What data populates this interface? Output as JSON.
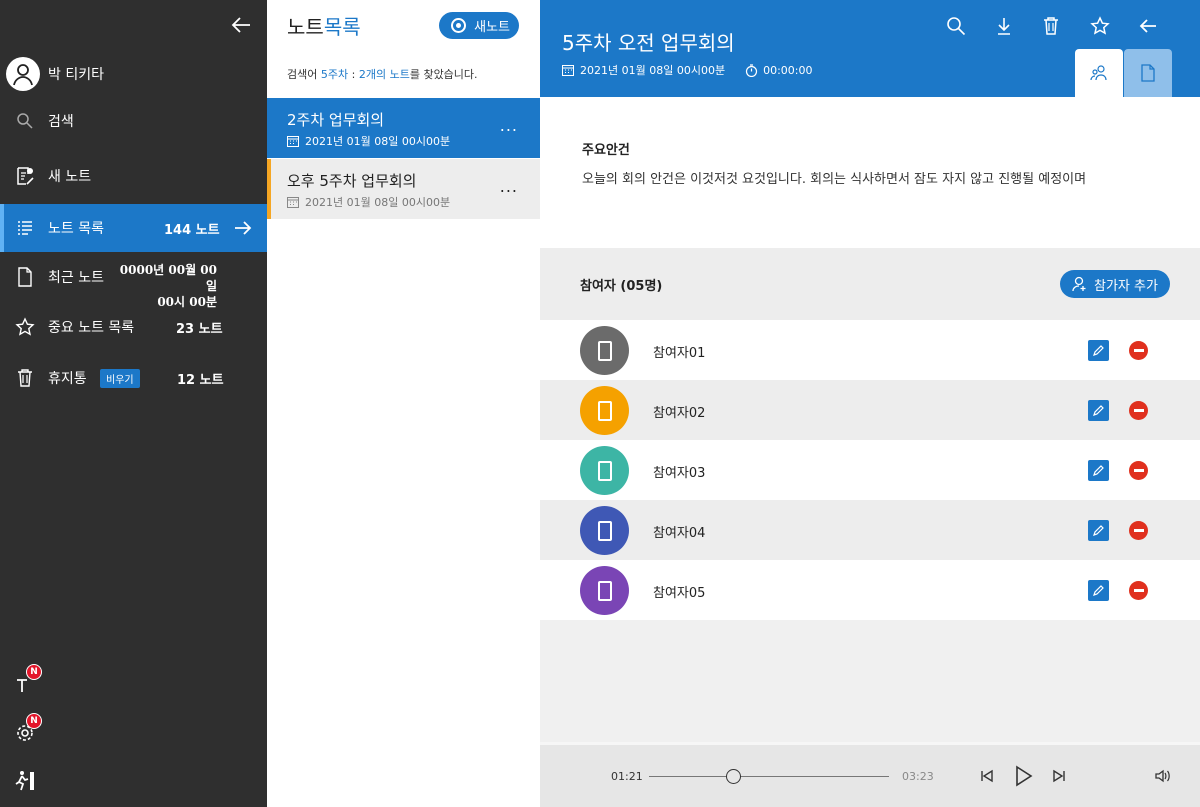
{
  "sidebar": {
    "user_name": "박 티키타",
    "items": [
      {
        "label": "검색"
      },
      {
        "label": "새 노트"
      },
      {
        "label": "노트 목록",
        "count": "144 노트"
      },
      {
        "label": "최근 노트",
        "date_line1": "0000년 00월 00일",
        "date_line2": "00시 00분"
      },
      {
        "label": "중요 노트 목록",
        "count": "23 노트"
      },
      {
        "label": "휴지통",
        "badge": "비우기",
        "count": "12 노트"
      }
    ],
    "bottom": {
      "badge_1": "N",
      "badge_2": "N"
    }
  },
  "notelist": {
    "title_part1": "노트",
    "title_part2": "목록",
    "new_button": "새노트",
    "search": {
      "prefix": "검색어",
      "keyword": "5주차",
      "colon": ":",
      "result": "2개의 노트",
      "suffix": "를 찾았습니다."
    },
    "notes": [
      {
        "title": "2주차 업무회의",
        "date": "2021년 01월 08일  00시00분",
        "more": "..."
      },
      {
        "title": "오후 5주차 업무회의",
        "date": "2021년 01월 08일  00시00분",
        "more": "..."
      }
    ]
  },
  "detail": {
    "title": "5주차 오전 업무회의",
    "date": "2021년 01월 08일  00시00분",
    "duration": "00:00:00",
    "agenda_title": "주요안건",
    "agenda_text": "오늘의 회의 안건은 이것저것 요것입니다. 회의는 식사하면서 잠도 자지 않고 진행될 예정이며",
    "participants_title": "참여자 (05명)",
    "add_participant": "참가자 추가",
    "participants": [
      {
        "name": "참여자01",
        "color": "#6b6b6b"
      },
      {
        "name": "참여자02",
        "color": "#f5a100"
      },
      {
        "name": "참여자03",
        "color": "#3db5a5"
      },
      {
        "name": "참여자04",
        "color": "#3f58b5"
      },
      {
        "name": "참여자05",
        "color": "#7a45b5"
      }
    ]
  },
  "player": {
    "current": "01:21",
    "total": "03:23",
    "progress": 0.35
  },
  "colors": {
    "accent": "#1c78c8",
    "sidebar": "#2f2f2f",
    "danger": "#e0301e",
    "highlight": "#f5a623"
  }
}
